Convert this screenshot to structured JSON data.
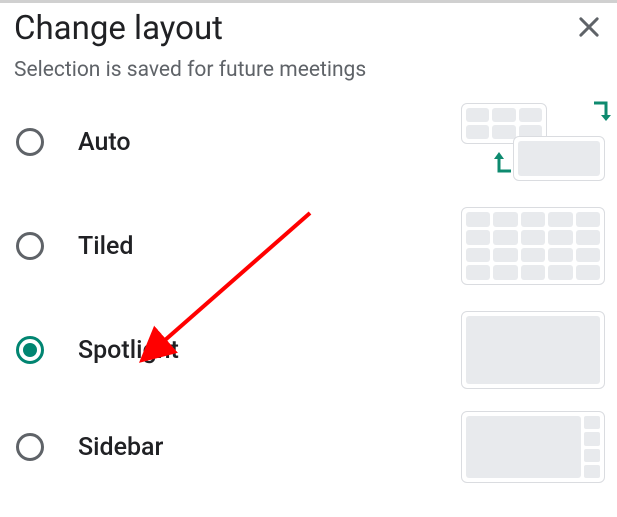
{
  "dialog": {
    "title": "Change layout",
    "subtitle": "Selection is saved for future meetings",
    "close_name": "close-icon"
  },
  "selected": "spotlight",
  "options": [
    {
      "key": "auto",
      "label": "Auto"
    },
    {
      "key": "tiled",
      "label": "Tiled"
    },
    {
      "key": "spotlight",
      "label": "Spotlight"
    },
    {
      "key": "sidebar",
      "label": "Sidebar"
    }
  ],
  "annotation": {
    "type": "arrow",
    "color": "#ff0000",
    "from_desc": "upper-center area",
    "to": "spotlight"
  }
}
